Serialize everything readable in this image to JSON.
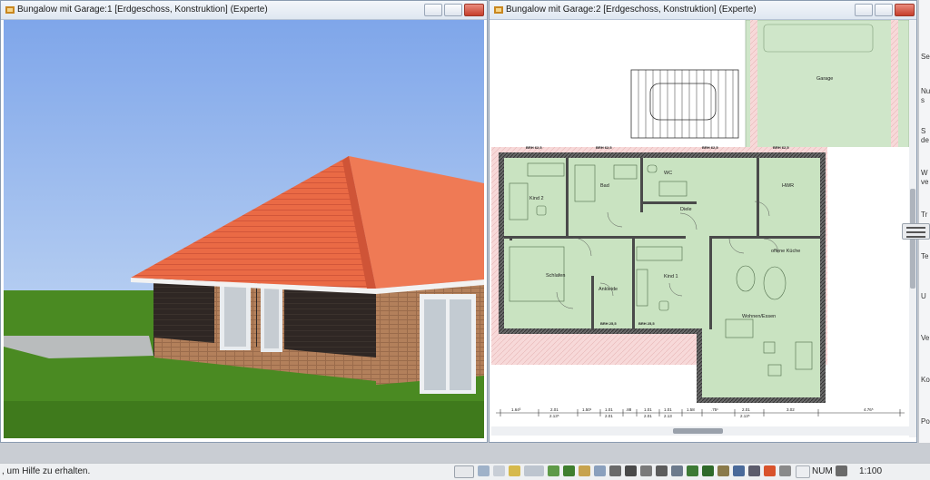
{
  "left_window": {
    "title": "Bungalow mit Garage:1 [Erdgeschoss, Konstruktion] (Experte)",
    "view_type": "3D exterior view"
  },
  "right_window": {
    "title": "Bungalow mit Garage:2 [Erdgeschoss, Konstruktion] (Experte)",
    "rooms": {
      "garage": "Garage",
      "kind2": "Kind 2",
      "bad": "Bad",
      "wc": "WC",
      "hwr": "HWR",
      "diele": "Diele",
      "schlafen": "Schlafen",
      "ankleide": "Ankleide",
      "kind1": "Kind 1",
      "kueche": "offene Küche",
      "wohnen": "Wohnen/Essen"
    },
    "brh_labels": {
      "b1": "BRH 62,5",
      "b2": "BRH 62,5",
      "b3": "BRH 62,5",
      "b4": "BRH 62,5",
      "b5": "BRH 25,5",
      "b6": "BRH 25,5"
    },
    "dimensions": {
      "d1": "1.64³",
      "d2": "2.01",
      "d2b": "2.13⁵",
      "d3": "1.50¹",
      "d4": "1.01",
      "d4b": "2.01",
      "d5": ".88",
      "d6": "1.01",
      "d6b": "2.01",
      "d7": "1.01",
      "d7b": "2.13",
      "d8": "1.58",
      "d9": ".75¹",
      "d10": "2.01",
      "d10b": "2.13⁵",
      "d11": "3.02",
      "d12": "4.76⁵"
    }
  },
  "side_panel": {
    "items": [
      "Se",
      "Nu",
      "s",
      "S",
      "de",
      "W",
      "ve",
      "Tr",
      "Te",
      "U",
      "Ve",
      "Ko",
      "Po"
    ]
  },
  "status_bar": {
    "help_text": ", um Hilfe zu erhalten.",
    "num_indicator": "NUM",
    "scale": "1:100"
  },
  "colors": {
    "roof": "#e8623f",
    "brick_dark": "#2b2421",
    "brick_light": "#b3805b",
    "sky": "#8cb1ec",
    "grass": "#4b8a24",
    "room_fill": "#c9e3c1",
    "wall": "#4a4a4a"
  }
}
